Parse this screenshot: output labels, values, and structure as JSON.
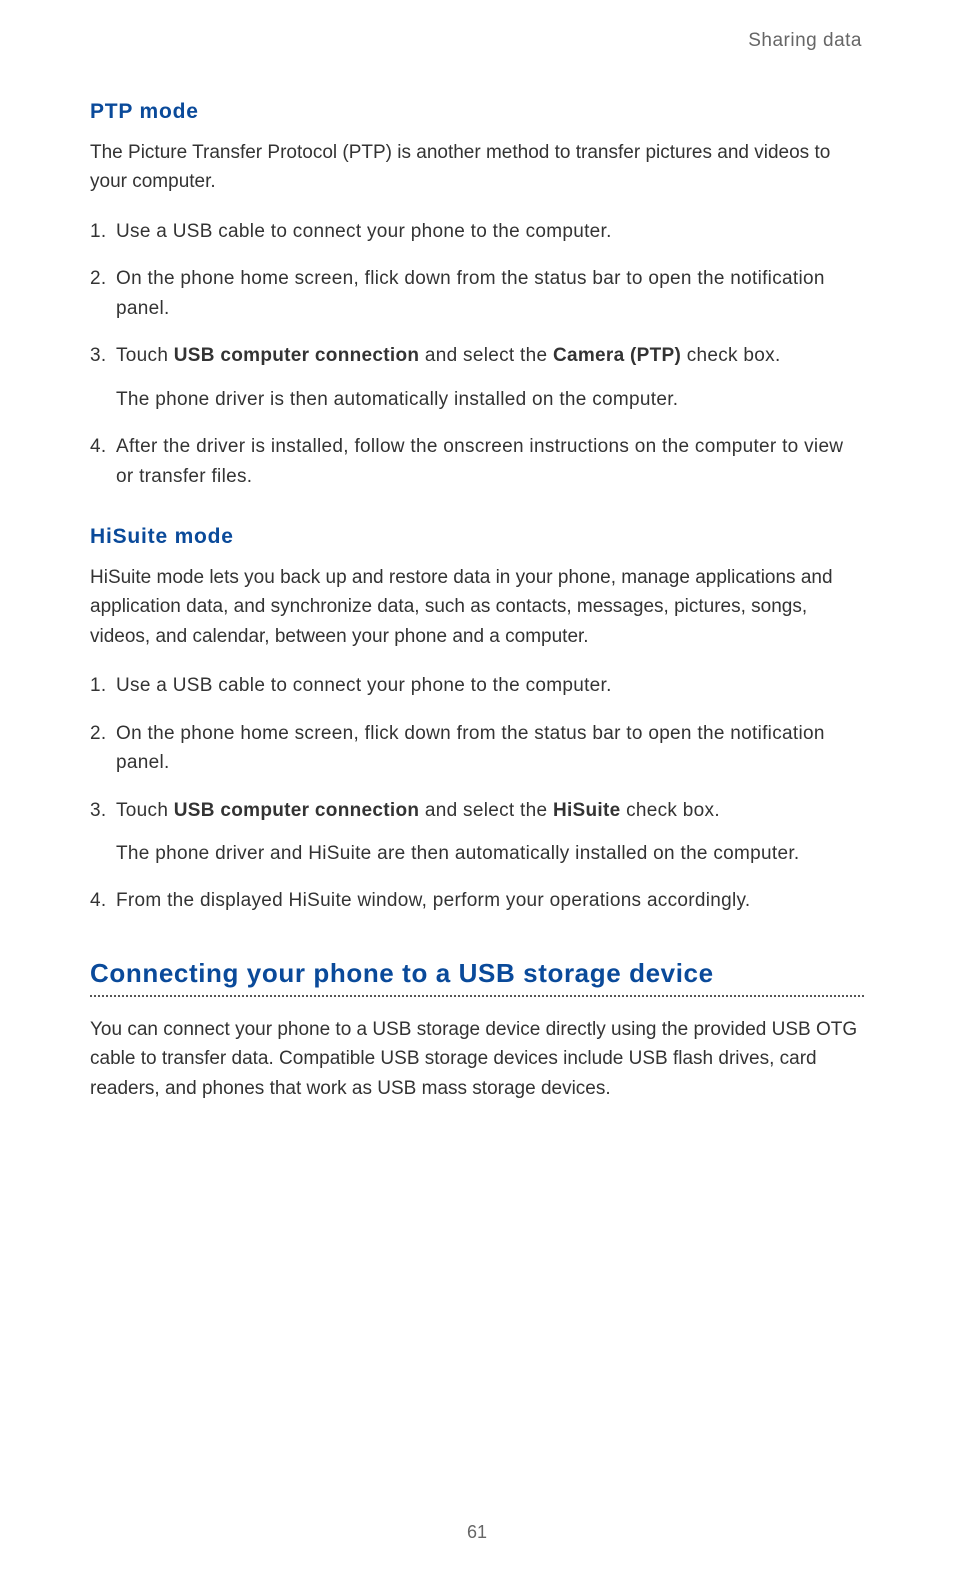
{
  "header": {
    "chapter": "Sharing data"
  },
  "ptp": {
    "heading": "PTP  mode",
    "intro": "The Picture Transfer Protocol (PTP) is another method to transfer pictures and videos to your computer.",
    "steps": {
      "s1": "Use a USB cable to connect your phone to the computer.",
      "s2": "On the phone home screen, flick down from the status bar to open the notification panel.",
      "s3_a": "Touch ",
      "s3_b": "USB computer connection",
      "s3_c": " and select the ",
      "s3_d": "Camera (PTP)",
      "s3_e": " check box.",
      "s3_note": "The phone driver is then automatically installed on the computer.",
      "s4": "After the driver is installed, follow the onscreen instructions on the computer to view or transfer files."
    }
  },
  "hisuite": {
    "heading": "HiSuite  mode",
    "intro": "HiSuite mode lets you back up and restore data in your phone, manage applications and application data, and synchronize data, such as contacts, messages, pictures, songs, videos, and calendar, between your phone and a computer.",
    "steps": {
      "s1": "Use a USB cable to connect your phone to the computer.",
      "s2": "On the phone home screen, flick down from the status bar to open the notification panel.",
      "s3_a": "Touch ",
      "s3_b": "USB computer connection",
      "s3_c": " and select the ",
      "s3_d": "HiSuite",
      "s3_e": " check box.",
      "s3_note": "The phone driver and HiSuite are then automatically installed on the computer.",
      "s4": "From the displayed HiSuite window, perform your operations accordingly."
    }
  },
  "usb_storage": {
    "heading": "Connecting your phone to a USB storage device",
    "body": "You can connect your phone to a USB storage device directly using the provided USB OTG cable to transfer data. Compatible USB storage devices include USB flash drives, card readers, and phones that work as USB mass storage devices."
  },
  "page_number": "61"
}
